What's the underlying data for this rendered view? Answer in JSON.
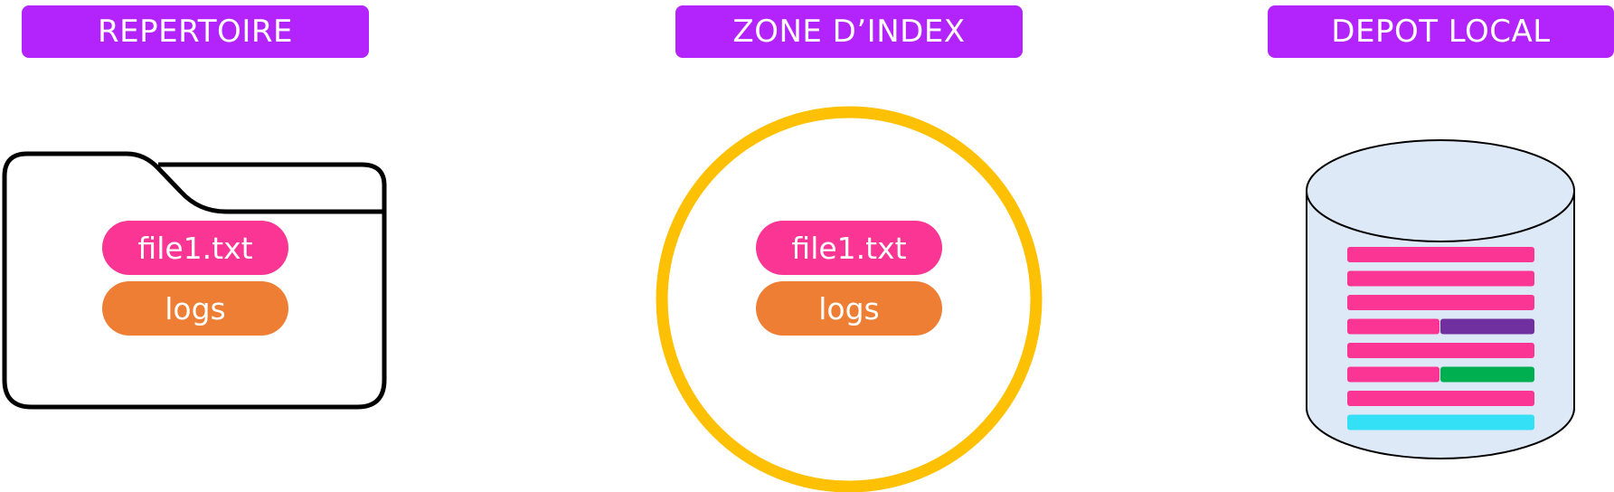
{
  "colors": {
    "header_bg": "#b324fc",
    "file_pill": "#fb3593",
    "logs_pill": "#ee7e34",
    "index_circle": "#fec002",
    "folder_stroke": "#000000",
    "cylinder_fill": "#dde9f6",
    "bar_pink": "#fb3593",
    "bar_purple": "#7030a0",
    "bar_green": "#00b050",
    "bar_cyan": "#33e0f5"
  },
  "columns": [
    {
      "title": "REPERTOIRE",
      "container": "folder-icon",
      "items": [
        "file1.txt",
        "logs"
      ]
    },
    {
      "title": "ZONE D’INDEX",
      "container": "circle",
      "items": [
        "file1.txt",
        "logs"
      ]
    },
    {
      "title": "DEPOT LOCAL",
      "container": "database-cylinder-icon",
      "commit_rows": [
        [
          "pink"
        ],
        [
          "pink"
        ],
        [
          "pink"
        ],
        [
          "pink",
          "purple"
        ],
        [
          "pink"
        ],
        [
          "pink",
          "green"
        ],
        [
          "pink"
        ],
        [
          "cyan"
        ]
      ]
    }
  ]
}
